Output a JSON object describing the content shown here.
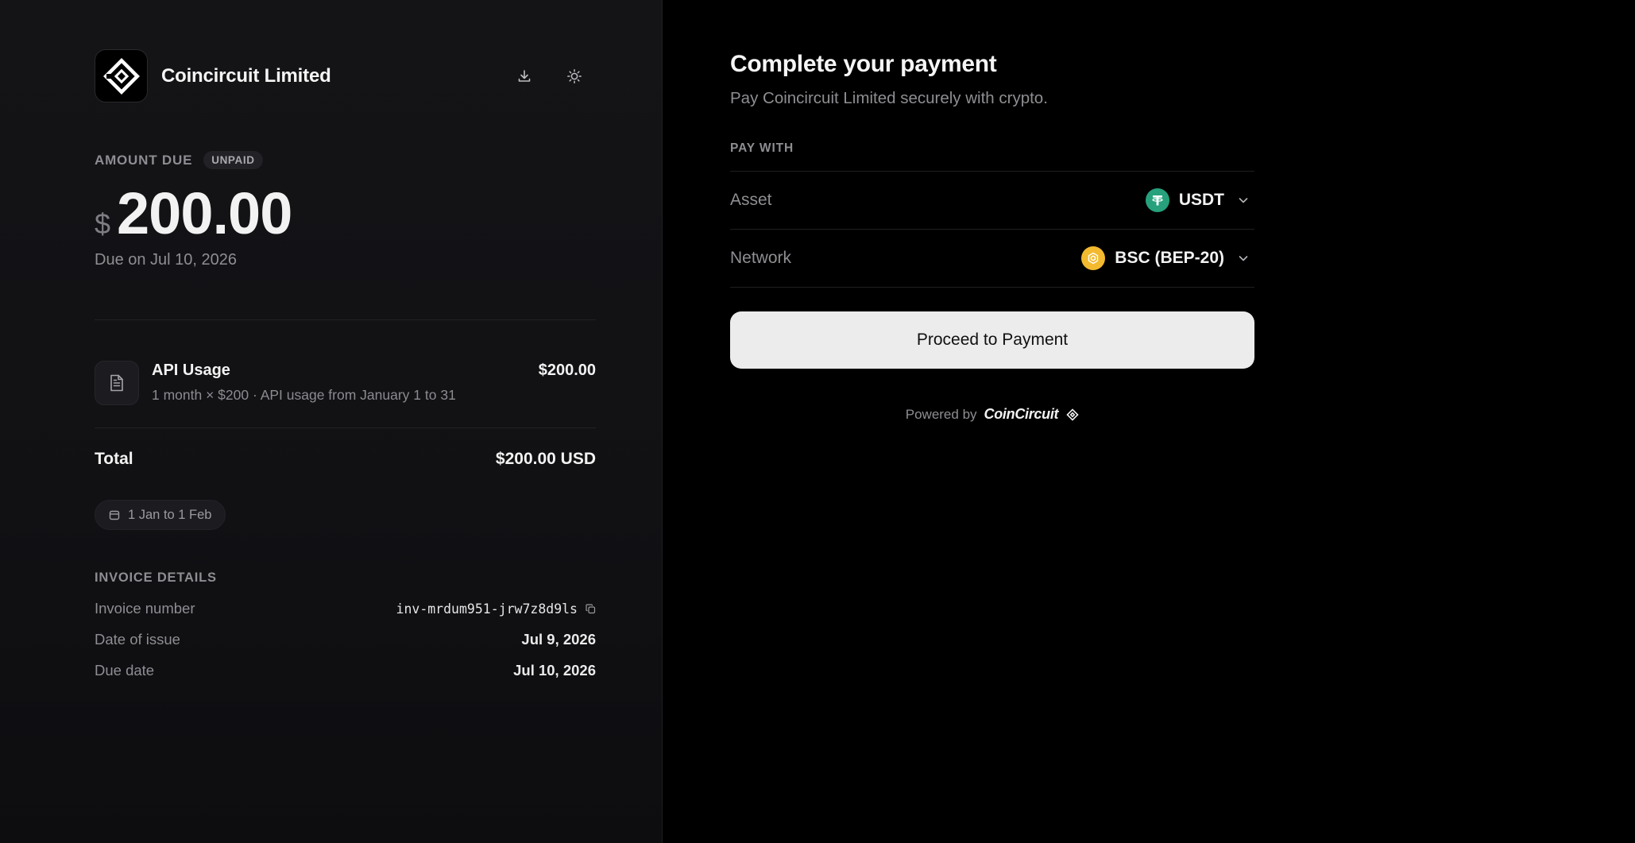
{
  "merchant": {
    "name": "Coincircuit Limited"
  },
  "toolbar": {
    "download_icon": "download-icon",
    "theme_icon": "sun-icon"
  },
  "amount_due": {
    "label": "AMOUNT DUE",
    "status": "UNPAID",
    "currency_symbol": "$",
    "value": "200.00",
    "due_text": "Due on Jul 10, 2026"
  },
  "line_items": [
    {
      "title": "API Usage",
      "description": "1 month × $200 · API usage from January 1 to 31",
      "amount": "$200.00",
      "icon": "document-icon"
    }
  ],
  "total": {
    "label": "Total",
    "value": "$200.00 USD"
  },
  "period": {
    "label": "1 Jan to 1 Feb",
    "icon": "calendar-icon"
  },
  "invoice_details": {
    "title": "INVOICE DETAILS",
    "rows": [
      {
        "label": "Invoice number",
        "value": "inv-mrdum951-jrw7z8d9ls"
      },
      {
        "label": "Date of issue",
        "value": "Jul 9, 2026"
      },
      {
        "label": "Due date",
        "value": "Jul 10, 2026"
      }
    ]
  },
  "payment": {
    "title": "Complete your payment",
    "subtitle": "Pay Coincircuit Limited securely with crypto.",
    "pay_with_label": "PAY WITH",
    "asset": {
      "label": "Asset",
      "value": "USDT",
      "icon": "tether-icon"
    },
    "network": {
      "label": "Network",
      "value": "BSC (BEP-20)",
      "icon": "bnb-icon"
    },
    "proceed_label": "Proceed to Payment",
    "powered_by_label": "Powered by",
    "powered_by_brand": "CoinCircuit"
  },
  "colors": {
    "tether": "#26a17b",
    "bnb": "#f3ba2f",
    "button_bg": "#ececec",
    "panel_bg": "#141417",
    "page_bg": "#000000"
  }
}
